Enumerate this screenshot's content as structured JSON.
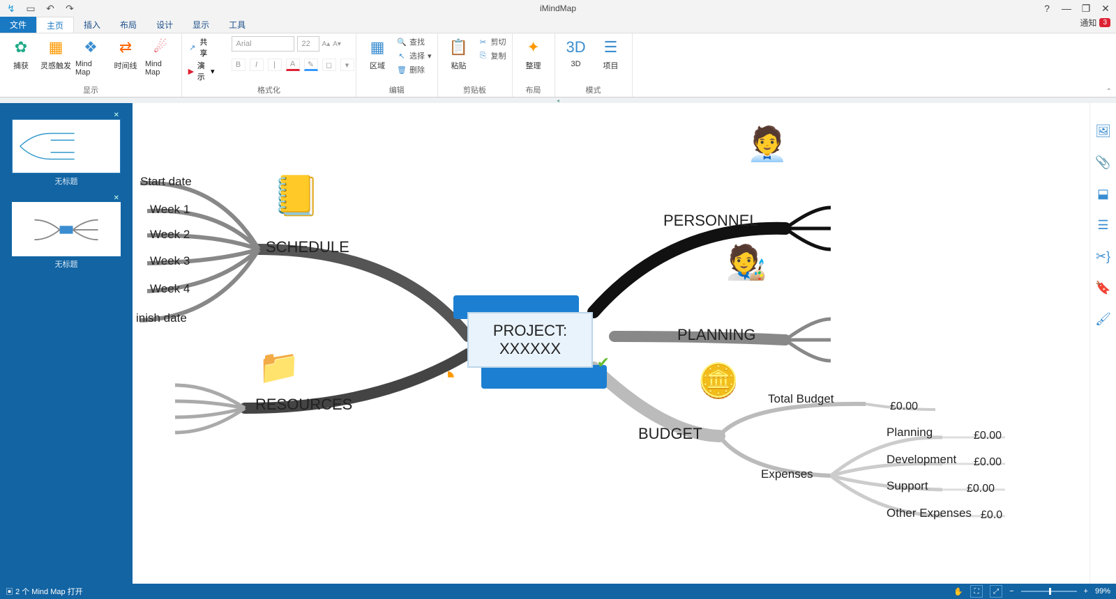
{
  "app": {
    "title": "iMindMap"
  },
  "qat": {
    "undo": "↶",
    "redo": "↷",
    "logo": "↯",
    "new": "▭"
  },
  "winControls": {
    "help": "?",
    "min": "—",
    "restore": "❐",
    "close": "✕"
  },
  "tabs": {
    "file": "文件",
    "home": "主页",
    "insert": "插入",
    "layout": "布局",
    "design": "设计",
    "view": "显示",
    "tools": "工具",
    "notify": "通知",
    "notifyCount": "3"
  },
  "ribbon": {
    "groups": {
      "display": {
        "label": "显示",
        "capture": "捕获",
        "inspire": "灵感触发",
        "mindmap": "Mind Map",
        "timeline": "时间线",
        "mindmap2": "Mind Map"
      },
      "format": {
        "label": "格式化",
        "share": "共享",
        "present": "演示",
        "font": "Arial",
        "size": "22",
        "bold": "B",
        "italic": "I"
      },
      "edit": {
        "label": "编辑",
        "region": "区域",
        "find": "查找",
        "select": "选择",
        "delete": "删除"
      },
      "clipboard": {
        "label": "剪贴板",
        "paste": "粘贴",
        "cut": "剪切",
        "copy": "复制"
      },
      "layout": {
        "label": "布局",
        "tidy": "整理"
      },
      "mode": {
        "label": "模式",
        "threeD": "3D",
        "project": "项目"
      }
    }
  },
  "thumbs": {
    "label1": "无标题",
    "label2": "无标题"
  },
  "mindmap": {
    "central": {
      "line1": "PROJECT:",
      "line2": "XXXXXX"
    },
    "schedule": {
      "title": "SCHEDULE",
      "start": "Start date",
      "w1": "Week 1",
      "w2": "Week 2",
      "w3": "Week 3",
      "w4": "Week 4",
      "finish": "inish date"
    },
    "resources": "RESOURCES",
    "personnel": "PERSONNEL",
    "planning": "PLANNING",
    "budget": {
      "title": "BUDGET",
      "total": {
        "label": "Total Budget",
        "value": "£0.00"
      },
      "expenses": "Expenses",
      "planning": {
        "label": "Planning",
        "value": "£0.00"
      },
      "development": {
        "label": "Development",
        "value": "£0.00"
      },
      "support": {
        "label": "Support",
        "value": "£0.00"
      },
      "other": {
        "label": "Other Expenses",
        "value": "£0.0"
      }
    }
  },
  "status": {
    "left": "2 个 Mind Map 打开",
    "zoom": "99%"
  }
}
